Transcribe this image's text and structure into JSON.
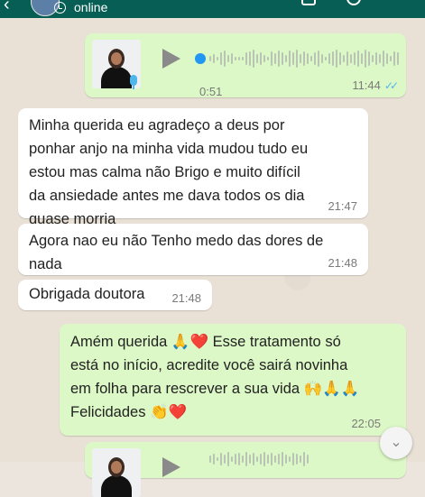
{
  "header": {
    "status": "online"
  },
  "messages": {
    "voice1": {
      "duration": "0:51",
      "time": "11:44"
    },
    "msg1": {
      "lines": [
        "Minha querida eu agradeço a deus por",
        "ponhar anjo na minha vida mudou tudo eu",
        "estou mas calma não Brigo e muito difícil",
        "da ansiedade antes me dava todos os dia",
        "quase morria"
      ],
      "time": "21:47"
    },
    "msg2": {
      "lines": [
        "Agora nao eu não Tenho medo das dores de",
        "nada"
      ],
      "time": "21:48"
    },
    "msg3": {
      "text": "Obrigada doutora",
      "time": "21:48"
    },
    "msg4": {
      "line1": "Amém querida",
      "line1b": "Esse tratamento só",
      "line2": "está no início, acredite você sairá novinha",
      "line3": "em folha para rescrever a sua vida",
      "line4": "Felicidades",
      "time": "22:05"
    }
  },
  "icons": {
    "read_ticks": "double-check-icon",
    "scroll": "chevron-double-down-icon"
  }
}
